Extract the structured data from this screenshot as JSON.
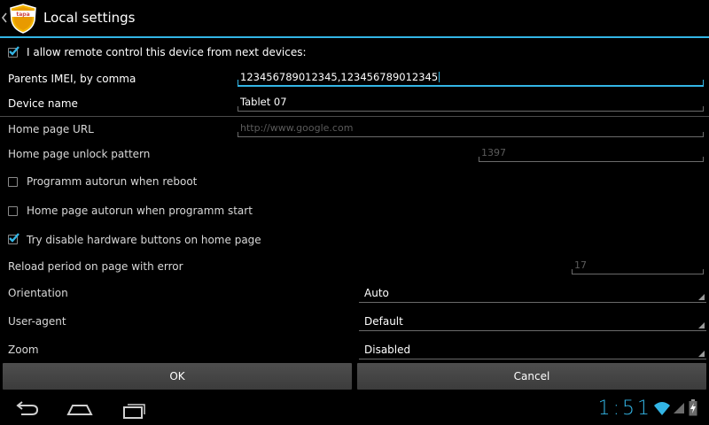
{
  "action_bar": {
    "title": "Local settings",
    "logo_text": "tapa"
  },
  "settings": {
    "remote_control": {
      "label": "I allow remote control this device from next devices:",
      "checked": true
    },
    "parents_imei": {
      "label": "Parents IMEI, by comma",
      "value": "123456789012345,123456789012345"
    },
    "device_name": {
      "label": "Device name",
      "value": "Tablet 07"
    },
    "home_page_url": {
      "label": "Home page URL",
      "placeholder": "http://www.google.com"
    },
    "unlock_pattern": {
      "label": "Home page unlock pattern",
      "placeholder": "1397"
    },
    "autorun_reboot": {
      "label": "Programm autorun when reboot",
      "checked": false
    },
    "autorun_start": {
      "label": "Home page autorun when programm start",
      "checked": false
    },
    "disable_hw_buttons": {
      "label": "Try disable hardware buttons on home page",
      "checked": true
    },
    "reload_period": {
      "label": "Reload period on page with error",
      "placeholder": "17"
    },
    "orientation": {
      "label": "Orientation",
      "value": "Auto"
    },
    "user_agent": {
      "label": "User-agent",
      "value": "Default"
    },
    "zoom": {
      "label": "Zoom",
      "value": "Disabled"
    }
  },
  "buttons": {
    "ok": "OK",
    "cancel": "Cancel"
  },
  "system_bar": {
    "clock": "1:51",
    "icons": [
      "back-icon",
      "home-icon",
      "recent-apps-icon",
      "wifi-icon",
      "signal-icon",
      "battery-icon"
    ]
  },
  "colors": {
    "accent": "#33b5e5",
    "background": "#000000",
    "button": "#464646"
  }
}
